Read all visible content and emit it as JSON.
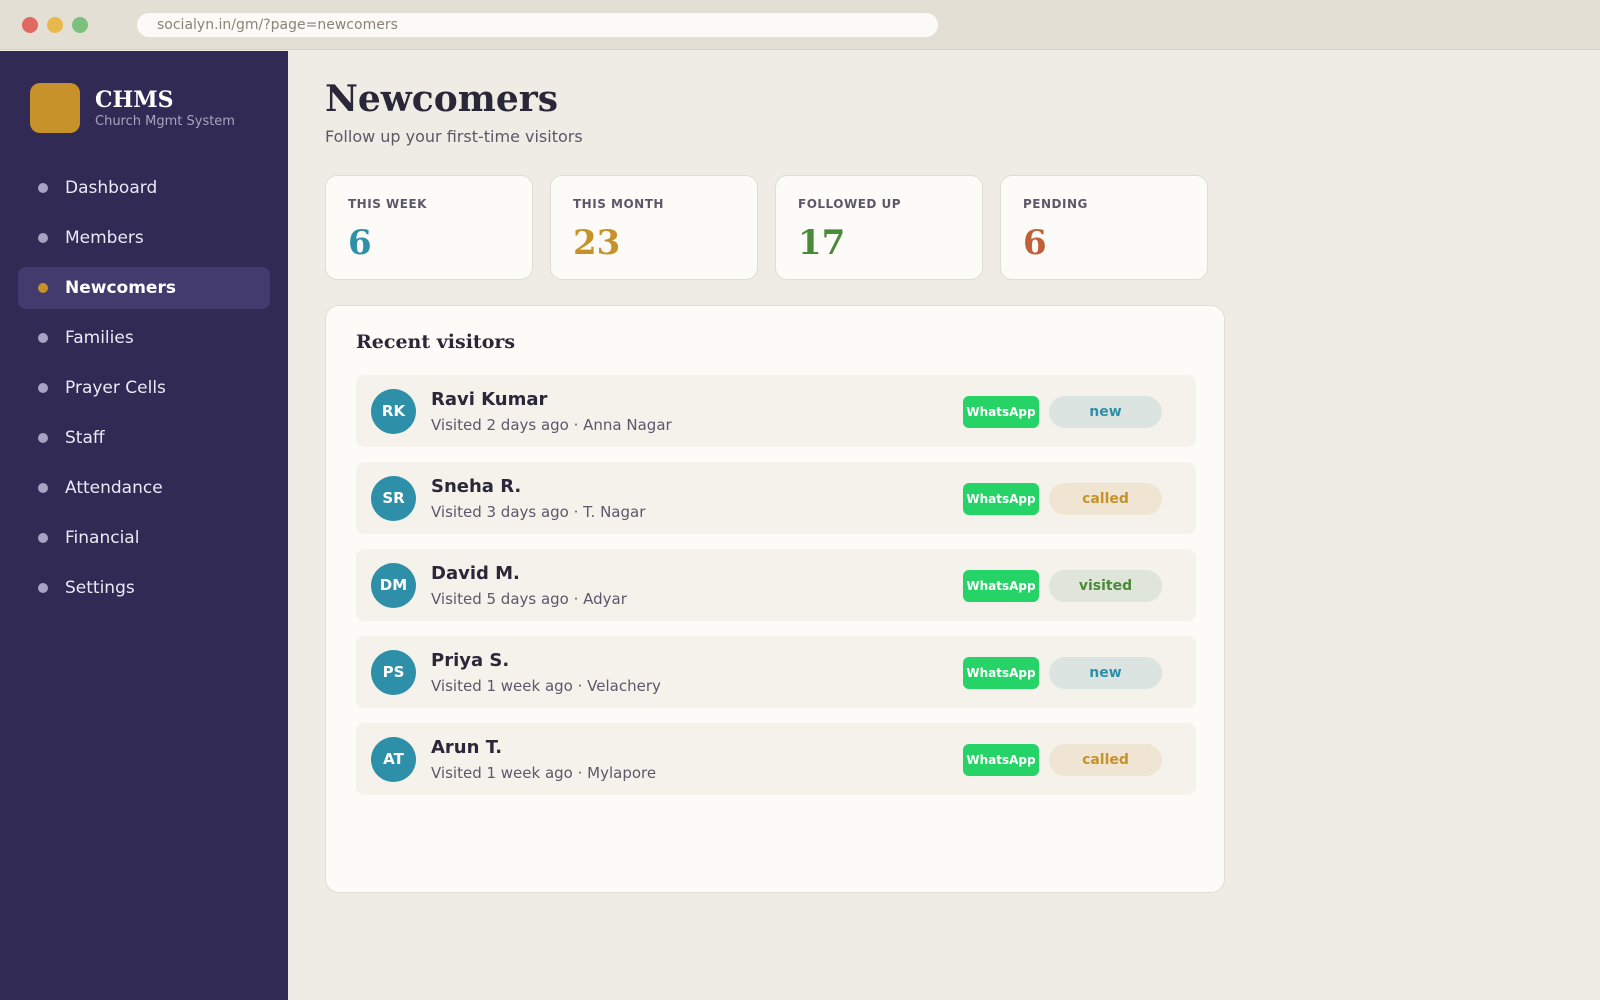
{
  "browser": {
    "url": "socialyn.in/gm/?page=newcomers"
  },
  "sidebar": {
    "brand": {
      "name": "CHMS",
      "subtitle": "Church Mgmt System"
    },
    "items": [
      {
        "label": "Dashboard",
        "active": false
      },
      {
        "label": "Members",
        "active": false
      },
      {
        "label": "Newcomers",
        "active": true
      },
      {
        "label": "Families",
        "active": false
      },
      {
        "label": "Prayer Cells",
        "active": false
      },
      {
        "label": "Staff",
        "active": false
      },
      {
        "label": "Attendance",
        "active": false
      },
      {
        "label": "Financial",
        "active": false
      },
      {
        "label": "Settings",
        "active": false
      }
    ]
  },
  "header": {
    "title": "Newcomers",
    "subtitle": "Follow up your first-time visitors"
  },
  "stats": [
    {
      "label": "THIS WEEK",
      "value": "6",
      "color": "#2e8fa8"
    },
    {
      "label": "THIS MONTH",
      "value": "23",
      "color": "#c8922a"
    },
    {
      "label": "FOLLOWED UP",
      "value": "17",
      "color": "#4a8a3a"
    },
    {
      "label": "PENDING",
      "value": "6",
      "color": "#c0603a"
    }
  ],
  "visitors": {
    "title": "Recent visitors",
    "whatsapp_label": "WhatsApp",
    "rows": [
      {
        "initials": "RK",
        "name": "Ravi Kumar",
        "meta": "Visited 2 days ago · Anna Nagar",
        "status": "new"
      },
      {
        "initials": "SR",
        "name": "Sneha R.",
        "meta": "Visited 3 days ago · T. Nagar",
        "status": "called"
      },
      {
        "initials": "DM",
        "name": "David M.",
        "meta": "Visited 5 days ago · Adyar",
        "status": "visited"
      },
      {
        "initials": "PS",
        "name": "Priya S.",
        "meta": "Visited 1 week ago · Velachery",
        "status": "new"
      },
      {
        "initials": "AT",
        "name": "Arun T.",
        "meta": "Visited 1 week ago · Mylapore",
        "status": "called"
      }
    ]
  },
  "colors": {
    "sidebar": "#302a55",
    "accent": "#c8922a",
    "whatsapp": "#25d366",
    "avatar": "#2e8fa8"
  }
}
